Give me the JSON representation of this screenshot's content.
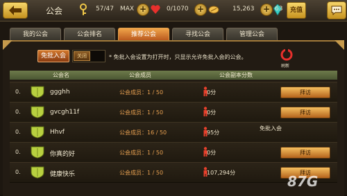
{
  "header": {
    "title": "公会",
    "key_count": "57/47",
    "max_label": "MAX",
    "hearts": "0/1070",
    "gold": "15,263",
    "gems": "63",
    "recharge_label": "充值"
  },
  "tabs": [
    {
      "label": "我的公会",
      "active": false
    },
    {
      "label": "公会排名",
      "active": false
    },
    {
      "label": "推荐公会",
      "active": true
    },
    {
      "label": "寻找公会",
      "active": false
    },
    {
      "label": "管理公会",
      "active": false
    }
  ],
  "filter": {
    "button_label": "免批入会",
    "toggle_label": "关闭",
    "hint": "* 免批入会设置为打开时，只显示允许免批入会的公会。",
    "refresh_label": "刷新"
  },
  "table": {
    "columns": [
      "公会名",
      "公会成员",
      "公会副本分数"
    ],
    "visit_label": "拜访",
    "rows": [
      {
        "rank": "0.",
        "name": "ggghh",
        "members": "公会成员：1 / 50",
        "score": "0分",
        "action": "visit"
      },
      {
        "rank": "0.",
        "name": "gvcgh11f",
        "members": "公会成员：1 / 50",
        "score": "0分",
        "action": "visit"
      },
      {
        "rank": "0.",
        "name": "Hhvf",
        "members": "公会成员：16 / 50",
        "score": "95分",
        "action": "free",
        "free_label": "免批入会"
      },
      {
        "rank": "0.",
        "name": "你真的好",
        "members": "公会成员：1 / 50",
        "score": "0分",
        "action": "visit"
      },
      {
        "rank": "0.",
        "name": "健康快乐",
        "members": "公会成员：1 / 50",
        "score": "107,294分",
        "action": "visit"
      }
    ]
  },
  "watermark": "87G",
  "colors": {
    "accent": "#e0922e",
    "table_header": "#5d6a3e",
    "members_text": "#e8a050"
  }
}
